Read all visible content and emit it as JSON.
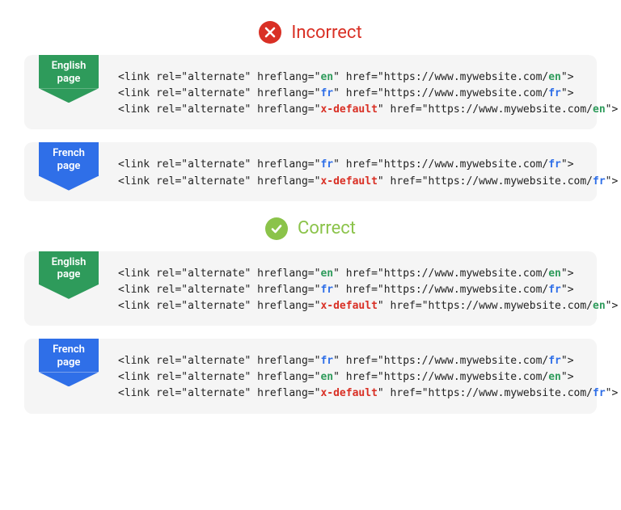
{
  "headers": {
    "incorrect": "Incorrect",
    "correct": "Correct"
  },
  "ribbons": {
    "english_l1": "English",
    "english_l2": "page",
    "french_l1": "French",
    "french_l2": "page"
  },
  "code_parts": {
    "open": "<link rel=\"alternate\" hreflang=\"",
    "mid": "\" href=\"https://www.mywebsite.com/",
    "close": "\">",
    "en": "en",
    "fr": "fr",
    "xdefault": "x-default"
  },
  "sections": [
    {
      "id": "incorrect",
      "cards": [
        {
          "ribbon": "english",
          "lines": [
            {
              "lang": "en",
              "path": "en"
            },
            {
              "lang": "fr",
              "path": "fr"
            },
            {
              "lang": "xdefault",
              "path": "en"
            }
          ]
        },
        {
          "ribbon": "french",
          "lines": [
            {
              "lang": "fr",
              "path": "fr"
            },
            {
              "lang": "xdefault",
              "path": "fr"
            }
          ]
        }
      ]
    },
    {
      "id": "correct",
      "cards": [
        {
          "ribbon": "english",
          "lines": [
            {
              "lang": "en",
              "path": "en"
            },
            {
              "lang": "fr",
              "path": "fr"
            },
            {
              "lang": "xdefault",
              "path": "en"
            }
          ]
        },
        {
          "ribbon": "french",
          "lines": [
            {
              "lang": "fr",
              "path": "fr"
            },
            {
              "lang": "en",
              "path": "en"
            },
            {
              "lang": "xdefault",
              "path": "fr"
            }
          ]
        }
      ]
    }
  ]
}
